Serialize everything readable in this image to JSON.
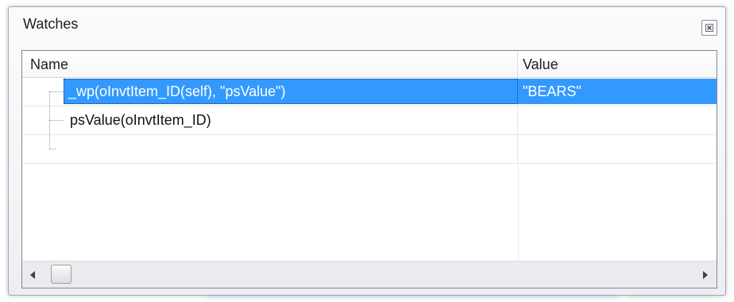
{
  "window": {
    "title": "Watches",
    "close_icon": "close-icon"
  },
  "columns": {
    "name": "Name",
    "value": "Value"
  },
  "rows": [
    {
      "name": "_wp(oInvtItem_ID(self), \"psValue\")",
      "value": "\"BEARS\"",
      "selected": true
    },
    {
      "name": "psValue(oInvtItem_ID)",
      "value": "",
      "selected": false
    },
    {
      "name": "",
      "value": "",
      "selected": false
    }
  ],
  "scrollbar": {
    "left_icon": "scroll-left-arrow-icon",
    "right_icon": "scroll-right-arrow-icon"
  },
  "colors": {
    "selection": "#3399ff",
    "border": "#828790"
  }
}
